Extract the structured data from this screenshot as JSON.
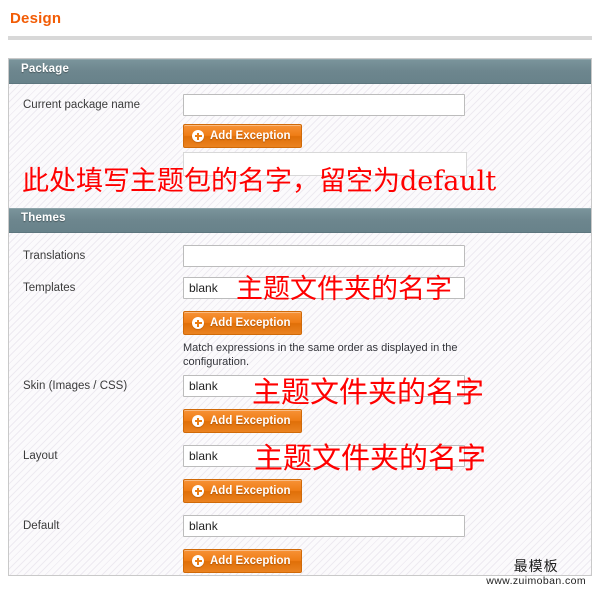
{
  "page": {
    "title": "Design"
  },
  "sections": [
    {
      "id": "package",
      "title": "Package",
      "rows": [
        {
          "label": "Current package name",
          "value": "",
          "button": "Add Exception"
        }
      ]
    },
    {
      "id": "themes",
      "title": "Themes",
      "rows": [
        {
          "label": "Translations",
          "value": ""
        },
        {
          "label": "Templates",
          "value": "blank",
          "button": "Add Exception",
          "hint": "Match expressions in the same order as displayed in the configuration."
        },
        {
          "label": "Skin (Images / CSS)",
          "value": "blank",
          "button": "Add Exception"
        },
        {
          "label": "Layout",
          "value": "blank",
          "button": "Add Exception"
        },
        {
          "label": "Default",
          "value": "blank",
          "button": "Add Exception"
        }
      ]
    }
  ],
  "annotations": {
    "package_note": "此处填写主题包的名字，留空为default",
    "templates_note": "主题文件夹的名字",
    "skin_note": "主题文件夹的名字",
    "layout_note": "主题文件夹的名字"
  },
  "watermark": {
    "name": "最模板",
    "url": "www.zuimoban.com"
  },
  "colors": {
    "accent_orange": "#f25c05",
    "section_header": "#6d868e",
    "annotation_red": "#ff0000",
    "button_orange": "#ef7d16"
  }
}
